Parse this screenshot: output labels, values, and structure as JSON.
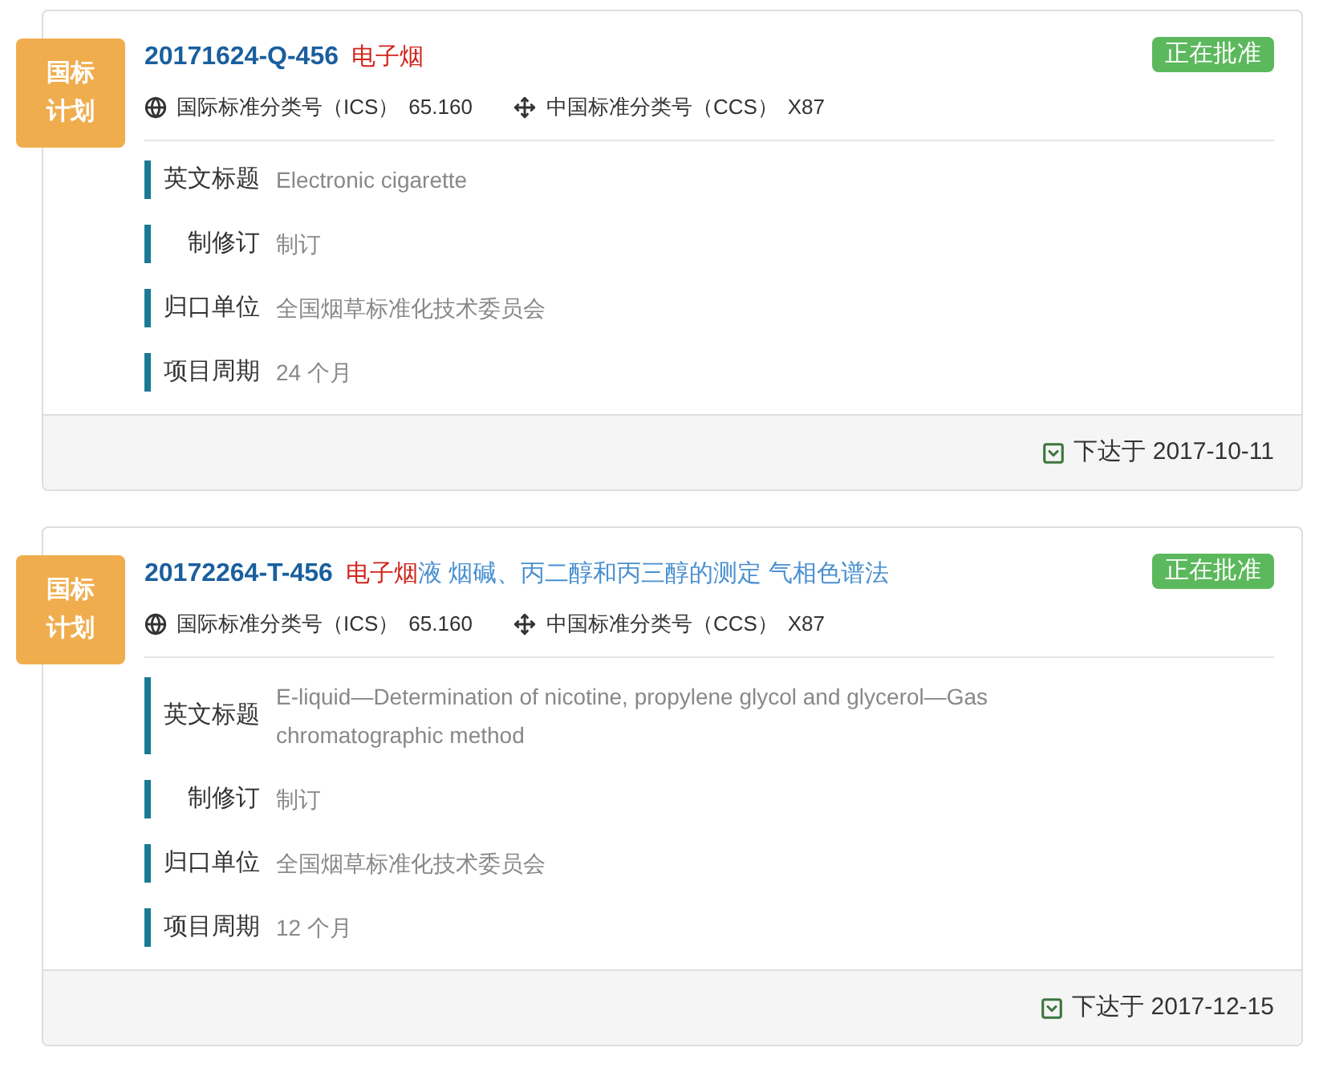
{
  "plans": [
    {
      "badge": "国标计划",
      "code": "20171624-Q-456",
      "title_parts": [
        {
          "text": "电子烟",
          "highlight": true
        }
      ],
      "status": "正在批准",
      "ics_label": "国际标准分类号（ICS）",
      "ics": "65.160",
      "ccs_label": "中国标准分类号（CCS）",
      "ccs": "X87",
      "fields": [
        {
          "label": "英文标题",
          "value": "Electronic cigarette"
        },
        {
          "label": "制修订",
          "value": "制订"
        },
        {
          "label": "归口单位",
          "value": "全国烟草标准化技术委员会"
        },
        {
          "label": "项目周期",
          "value": "24 个月"
        }
      ],
      "issued": "下达于 2017-10-11"
    },
    {
      "badge": "国标计划",
      "code": "20172264-T-456",
      "title_parts": [
        {
          "text": "电子烟",
          "highlight": true
        },
        {
          "text": "液 烟碱、丙二醇和丙三醇的测定 气相色谱法",
          "highlight": false
        }
      ],
      "status": "正在批准",
      "ics_label": "国际标准分类号（ICS）",
      "ics": "65.160",
      "ccs_label": "中国标准分类号（CCS）",
      "ccs": "X87",
      "fields": [
        {
          "label": "英文标题",
          "value": "E-liquid—Determination of nicotine, propylene glycol and glycerol—Gas chromatographic method"
        },
        {
          "label": "制修订",
          "value": "制订"
        },
        {
          "label": "归口单位",
          "value": "全国烟草标准化技术委员会"
        },
        {
          "label": "项目周期",
          "value": "12 个月"
        }
      ],
      "issued": "下达于 2017-12-15"
    }
  ]
}
